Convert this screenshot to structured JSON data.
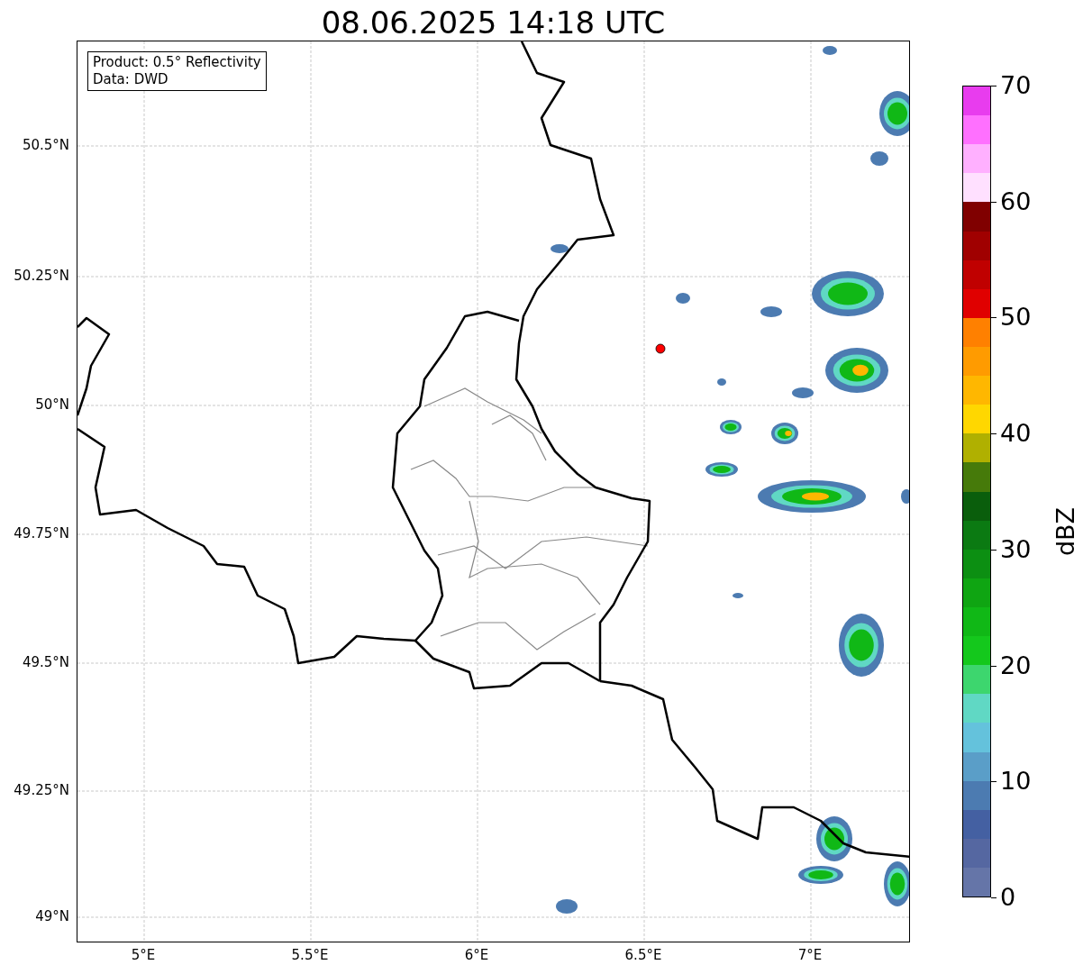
{
  "title": "08.06.2025 14:18 UTC",
  "info_box": {
    "lines": [
      "Product: 0.5° Reflectivity",
      "Data: DWD"
    ]
  },
  "map": {
    "lat_labels": [
      "50.5°N",
      "50.25°N",
      "50°N",
      "49.75°N",
      "49.5°N",
      "49.25°N",
      "49°N"
    ],
    "lon_labels": [
      "5°E",
      "5.5°E",
      "6°E",
      "6.5°E",
      "7°E"
    ]
  },
  "colorbar": {
    "label": "dBZ",
    "ticks": [
      "70",
      "60",
      "50",
      "40",
      "30",
      "20",
      "10",
      "0"
    ],
    "bins": [
      {
        "color": "#e83cee"
      },
      {
        "color": "#ff70ff"
      },
      {
        "color": "#ffb0ff"
      },
      {
        "color": "#ffe0ff"
      },
      {
        "color": "#800000"
      },
      {
        "color": "#a00000"
      },
      {
        "color": "#c00000"
      },
      {
        "color": "#e00000"
      },
      {
        "color": "#ff8000"
      },
      {
        "color": "#ff9b00"
      },
      {
        "color": "#ffb700"
      },
      {
        "color": "#ffd700"
      },
      {
        "color": "#b0b000"
      },
      {
        "color": "#467a0a"
      },
      {
        "color": "#0a5e0c"
      },
      {
        "color": "#0b7a12"
      },
      {
        "color": "#0c8f12"
      },
      {
        "color": "#0fa512"
      },
      {
        "color": "#10b816"
      },
      {
        "color": "#14c81c"
      },
      {
        "color": "#3dd66e"
      },
      {
        "color": "#60d8c4"
      },
      {
        "color": "#64c2dc"
      },
      {
        "color": "#5a9ec8"
      },
      {
        "color": "#4c7bb1"
      },
      {
        "color": "#4460a2"
      },
      {
        "color": "#5567a1"
      },
      {
        "color": "#6575a8"
      }
    ]
  }
}
